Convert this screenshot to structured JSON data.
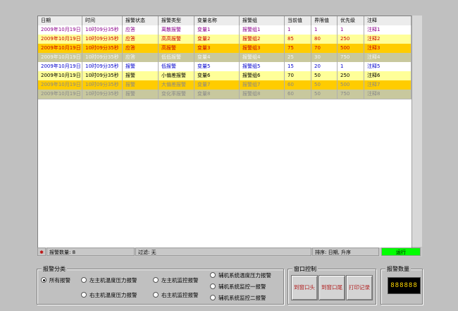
{
  "grid": {
    "columns": [
      "日期",
      "时间",
      "报警状态",
      "报警类型",
      "变量名称",
      "报警组",
      "当前值",
      "界限值",
      "优先级",
      "注释"
    ],
    "rows": [
      {
        "cells": [
          "2009年10月19日",
          "10时09分35秒",
          "应答",
          "离散报警",
          "变量1",
          "报警组1",
          "1",
          "1",
          "1",
          "注释1"
        ],
        "bg": "#ffffff",
        "fg": "#8b008b"
      },
      {
        "cells": [
          "2009年10月19日",
          "10时09分35秒",
          "应答",
          "高高报警",
          "变量2",
          "报警组2",
          "85",
          "80",
          "250",
          "注释2"
        ],
        "bg": "#ffff99",
        "fg": "#cc0000"
      },
      {
        "cells": [
          "2009年10月19日",
          "10时09分35秒",
          "应答",
          "高报警",
          "变量3",
          "报警组3",
          "75",
          "70",
          "500",
          "注释3"
        ],
        "bg": "#ffcc00",
        "fg": "#cc0000"
      },
      {
        "cells": [
          "2009年10月19日",
          "10时09分35秒",
          "应答",
          "低低报警",
          "变量4",
          "报警组4",
          "25",
          "30",
          "750",
          "注释4"
        ],
        "bg": "#c8c89e",
        "fg": "#f5f5f5"
      },
      {
        "cells": [
          "2009年10月19日",
          "10时09分35秒",
          "报警",
          "低报警",
          "变量5",
          "报警组5",
          "15",
          "20",
          "1",
          "注释5"
        ],
        "bg": "#ffffff",
        "fg": "#0000cc"
      },
      {
        "cells": [
          "2009年10月19日",
          "10时09分35秒",
          "报警",
          "小偏差报警",
          "变量6",
          "报警组6",
          "70",
          "50",
          "250",
          "注释6"
        ],
        "bg": "#ffff99",
        "fg": "#000000"
      },
      {
        "cells": [
          "2009年10月19日",
          "10时09分35秒",
          "报警",
          "大偏差报警",
          "变量7",
          "报警组7",
          "60",
          "50",
          "500",
          "注释7"
        ],
        "bg": "#ffcc00",
        "fg": "#888888"
      },
      {
        "cells": [
          "2009年10月19日",
          "10时09分35秒",
          "报警",
          "变化率报警",
          "变量8",
          "报警组8",
          "60",
          "50",
          "750",
          "注释8"
        ],
        "bg": "#c8c89e",
        "fg": "#888888"
      }
    ]
  },
  "status": {
    "count_label": "报警数量:  8",
    "filter_label": "过滤:  无",
    "sort_label": "排序:  日期,  升序",
    "run_label": "运行",
    "run_color": "#00ff00"
  },
  "category": {
    "title": "报警分类",
    "options": [
      "所有报警",
      "左主机温度压力报警",
      "左主机监控报警",
      "辅机系统温度压力报警",
      "右主机温度压力报警",
      "右主机监控报警",
      "辅机系统监控一报警",
      "辅机系统监控二报警"
    ]
  },
  "window_control": {
    "title": "窗口控制",
    "buttons": [
      "到窗口头",
      "到窗口尾",
      "打印记录"
    ]
  },
  "alarm_count": {
    "title": "报警数量",
    "display": "888888"
  }
}
